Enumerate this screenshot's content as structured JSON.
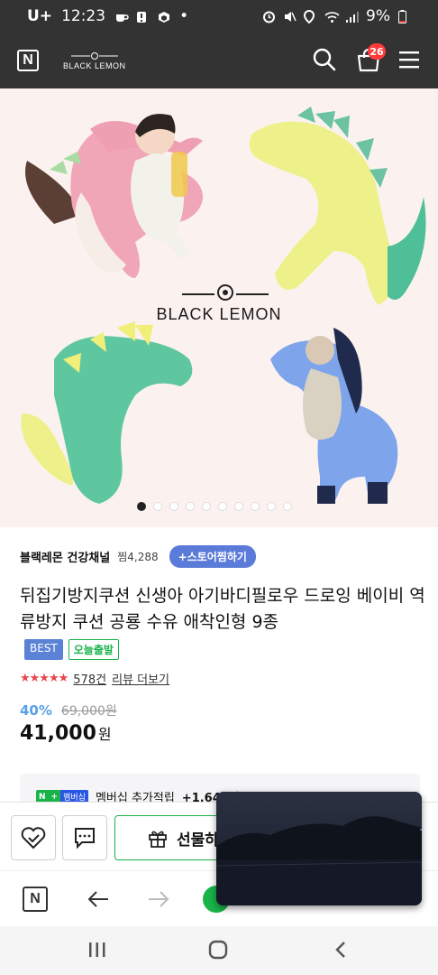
{
  "status_bar": {
    "carrier": "U+",
    "time": "12:23",
    "dot": "•",
    "battery": "9%"
  },
  "header": {
    "logo_letter": "N",
    "brand": "BLACK LEMON",
    "cart_count": "26",
    "icons": [
      "search-icon",
      "cart-icon",
      "menu-icon"
    ]
  },
  "hero": {
    "brand_text": "BLACK LEMON",
    "slide_count": 10,
    "active_slide": 1
  },
  "store": {
    "name": "블랙레몬 건강채널",
    "fav_count": "찜4,288",
    "follow_label": "+스토어찜하기"
  },
  "product": {
    "title": "뒤집기방지쿠션 신생아 아기바디필로우 드로잉 베이비 역류방지 쿠션 공룡 수유 애착인형 9종",
    "badges": {
      "best": "BEST",
      "today": "오늘출발"
    },
    "rating_stars": "★★★★★",
    "rating_value": 4.5,
    "review_count": "578건",
    "review_link": "리뷰 더보기",
    "discount_rate": "40%",
    "original_price": "69,000원",
    "price": "41,000",
    "price_unit": "원"
  },
  "membership": {
    "chip_n": "N",
    "chip_plus": "+",
    "chip_label": "멤버십",
    "text": "멤버십 추가적립",
    "amount": "+1,640원"
  },
  "action_bar": {
    "gift_label": "선물하기",
    "icons": [
      "heart-check-icon",
      "chat-icon",
      "gift-icon"
    ]
  },
  "browser_nav": {
    "logo_letter": "N",
    "icons": [
      "home-n-icon",
      "back-arrow-icon",
      "forward-arrow-icon"
    ]
  },
  "colors": {
    "header_bg": "#333333",
    "accent_green": "#19b34a",
    "follow_blue": "#5a7bd8",
    "discount_blue": "#5aa0e8",
    "badge_red": "#ff3b3b",
    "hero_bg": "#fbf2ef"
  }
}
